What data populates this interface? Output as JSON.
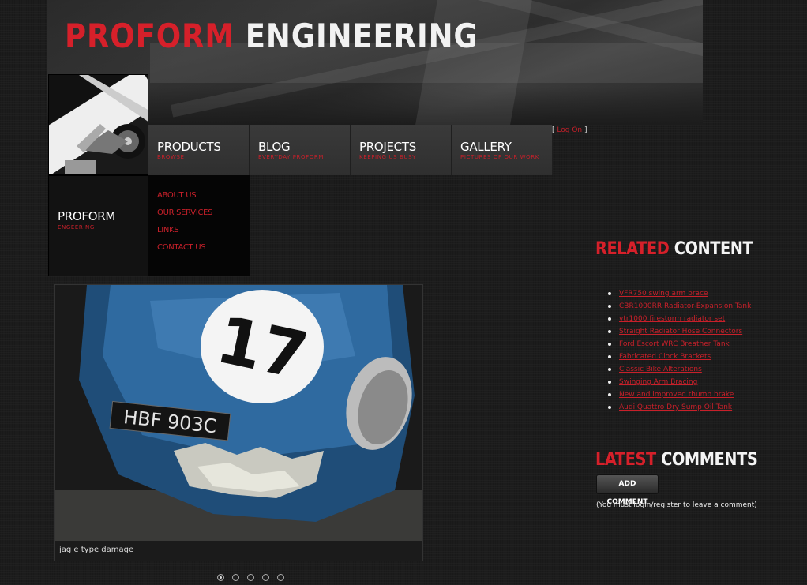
{
  "header": {
    "logo_word_red": "PROFORM",
    "logo_word_white": "ENGINEERING"
  },
  "login": {
    "prefix": "[",
    "link": "Log On",
    "suffix": "]"
  },
  "nav": [
    {
      "label": "PRODUCTS",
      "sub": "BROWSE"
    },
    {
      "label": "BLOG",
      "sub": "EVERYDAY PROFORM"
    },
    {
      "label": "PROJECTS",
      "sub": "KEEPING US BUSY"
    },
    {
      "label": "GALLERY",
      "sub": "PICTURES OF OUR WORK"
    }
  ],
  "brand": {
    "label": "PROFORM",
    "sub": "ENGEERING"
  },
  "submenu": [
    "ABOUT US",
    "OUR SERVICES",
    "LINKS",
    "CONTACT US"
  ],
  "slideshow": {
    "caption": "jag e type damage",
    "race_number": "17",
    "number_plate": "HBF 903C",
    "slide_count": 5,
    "active_slide": 1
  },
  "related": {
    "title_red": "RELATED",
    "title_white": "CONTENT",
    "items": [
      "VFR750 swing arm brace",
      "CBR1000RR Radiator-Expansion Tank",
      "vtr1000 firestorm radiator set",
      "Straight Radiator Hose Connectors",
      "Ford Escort WRC Breather Tank",
      "Fabricated Clock Brackets",
      "Classic Bike Alterations",
      "Swinging Arm Bracing",
      "New and improved thumb brake",
      "Audi Quattro Dry Sump Oil Tank"
    ]
  },
  "comments": {
    "title_red": "LATEST",
    "title_white": "COMMENTS",
    "button": "ADD COMMENT",
    "note": "(You must login/register to leave a comment)"
  },
  "colors": {
    "accent_red": "#d6202a",
    "background": "#1c1c1c"
  }
}
